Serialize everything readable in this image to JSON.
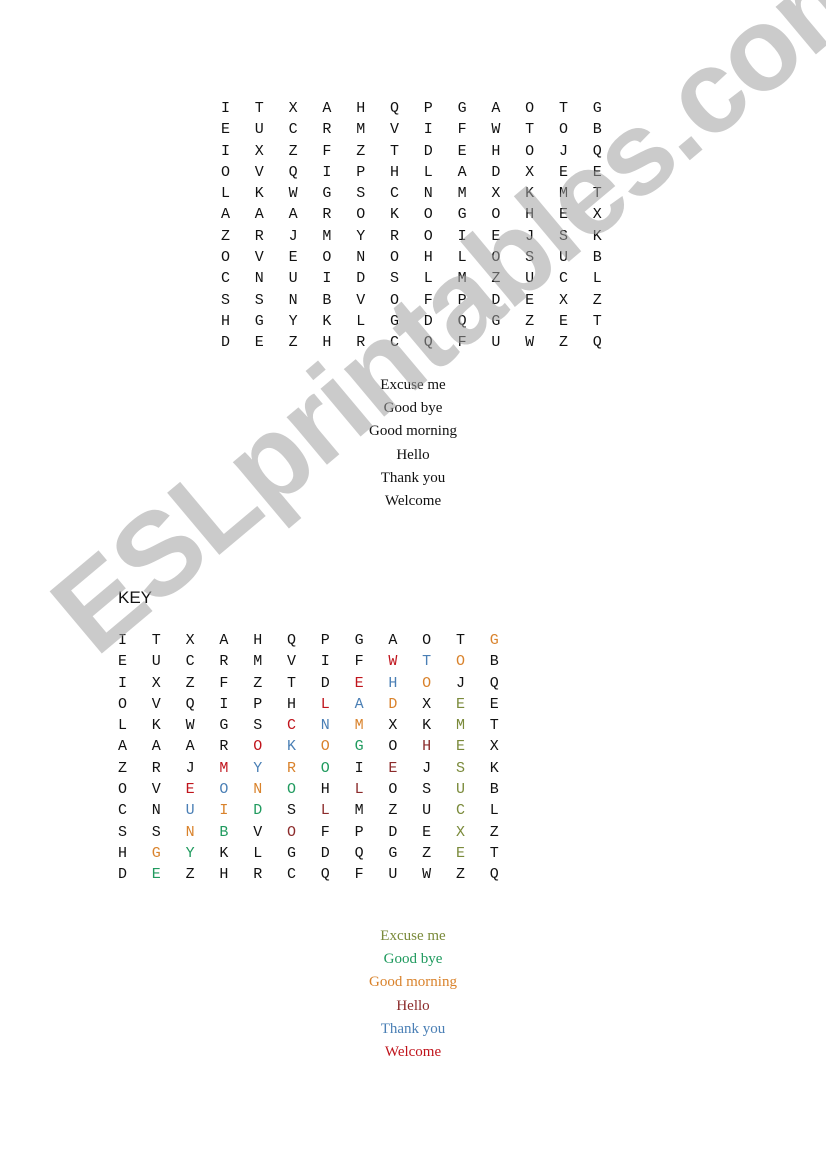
{
  "puzzle": {
    "grid": [
      [
        "I",
        "T",
        "X",
        "A",
        "H",
        "Q",
        "P",
        "G",
        "A",
        "O",
        "T",
        "G"
      ],
      [
        "E",
        "U",
        "C",
        "R",
        "M",
        "V",
        "I",
        "F",
        "W",
        "T",
        "O",
        "B"
      ],
      [
        "I",
        "X",
        "Z",
        "F",
        "Z",
        "T",
        "D",
        "E",
        "H",
        "O",
        "J",
        "Q"
      ],
      [
        "O",
        "V",
        "Q",
        "I",
        "P",
        "H",
        "L",
        "A",
        "D",
        "X",
        "E",
        "E"
      ],
      [
        "L",
        "K",
        "W",
        "G",
        "S",
        "C",
        "N",
        "M",
        "X",
        "K",
        "M",
        "T"
      ],
      [
        "A",
        "A",
        "A",
        "R",
        "O",
        "K",
        "O",
        "G",
        "O",
        "H",
        "E",
        "X"
      ],
      [
        "Z",
        "R",
        "J",
        "M",
        "Y",
        "R",
        "O",
        "I",
        "E",
        "J",
        "S",
        "K"
      ],
      [
        "O",
        "V",
        "E",
        "O",
        "N",
        "O",
        "H",
        "L",
        "O",
        "S",
        "U",
        "B"
      ],
      [
        "C",
        "N",
        "U",
        "I",
        "D",
        "S",
        "L",
        "M",
        "Z",
        "U",
        "C",
        "L"
      ],
      [
        "S",
        "S",
        "N",
        "B",
        "V",
        "O",
        "F",
        "P",
        "D",
        "E",
        "X",
        "Z"
      ],
      [
        "H",
        "G",
        "Y",
        "K",
        "L",
        "G",
        "D",
        "Q",
        "G",
        "Z",
        "E",
        "T"
      ],
      [
        "D",
        "E",
        "Z",
        "H",
        "R",
        "C",
        "Q",
        "F",
        "U",
        "W",
        "Z",
        "Q"
      ]
    ],
    "words": [
      "Excuse me",
      "Good bye",
      "Good morning",
      "Hello",
      "Thank you",
      "Welcome"
    ]
  },
  "key": {
    "title": "KEY",
    "colors": {
      "excuse_me": "#7a8a3a",
      "good_bye": "#1f9a5e",
      "good_morning": "#d9822b",
      "hello": "#8b2a2a",
      "thank_you": "#4a7fb5",
      "welcome": "#c0141c"
    },
    "words": [
      {
        "text": "Excuse me",
        "color_key": "excuse_me"
      },
      {
        "text": "Good bye",
        "color_key": "good_bye"
      },
      {
        "text": "Good morning",
        "color_key": "good_morning"
      },
      {
        "text": "Hello",
        "color_key": "hello"
      },
      {
        "text": "Thank you",
        "color_key": "thank_you"
      },
      {
        "text": "Welcome",
        "color_key": "welcome"
      }
    ],
    "highlights": [
      {
        "word": "good_morning",
        "cells": [
          [
            0,
            11
          ],
          [
            1,
            10
          ],
          [
            2,
            9
          ],
          [
            3,
            8
          ],
          [
            4,
            7
          ],
          [
            5,
            6
          ],
          [
            6,
            5
          ],
          [
            7,
            4
          ],
          [
            8,
            3
          ],
          [
            9,
            2
          ],
          [
            10,
            1
          ]
        ]
      },
      {
        "word": "welcome",
        "cells": [
          [
            1,
            8
          ],
          [
            2,
            7
          ],
          [
            3,
            6
          ],
          [
            4,
            5
          ],
          [
            5,
            4
          ],
          [
            6,
            3
          ],
          [
            7,
            2
          ]
        ]
      },
      {
        "word": "thank_you",
        "cells": [
          [
            1,
            9
          ],
          [
            2,
            8
          ],
          [
            3,
            7
          ],
          [
            4,
            6
          ],
          [
            5,
            5
          ],
          [
            6,
            4
          ],
          [
            7,
            3
          ],
          [
            8,
            2
          ]
        ]
      },
      {
        "word": "excuse_me",
        "cells": [
          [
            10,
            10
          ],
          [
            9,
            10
          ],
          [
            8,
            10
          ],
          [
            7,
            10
          ],
          [
            6,
            10
          ],
          [
            5,
            10
          ],
          [
            4,
            10
          ],
          [
            3,
            10
          ]
        ]
      },
      {
        "word": "good_bye",
        "cells": [
          [
            5,
            7
          ],
          [
            6,
            6
          ],
          [
            7,
            5
          ],
          [
            8,
            4
          ],
          [
            9,
            3
          ],
          [
            10,
            2
          ],
          [
            11,
            1
          ]
        ]
      },
      {
        "word": "hello",
        "cells": [
          [
            5,
            9
          ],
          [
            6,
            8
          ],
          [
            7,
            7
          ],
          [
            8,
            6
          ],
          [
            9,
            5
          ]
        ]
      }
    ]
  },
  "watermark": "ESLprintables.com"
}
